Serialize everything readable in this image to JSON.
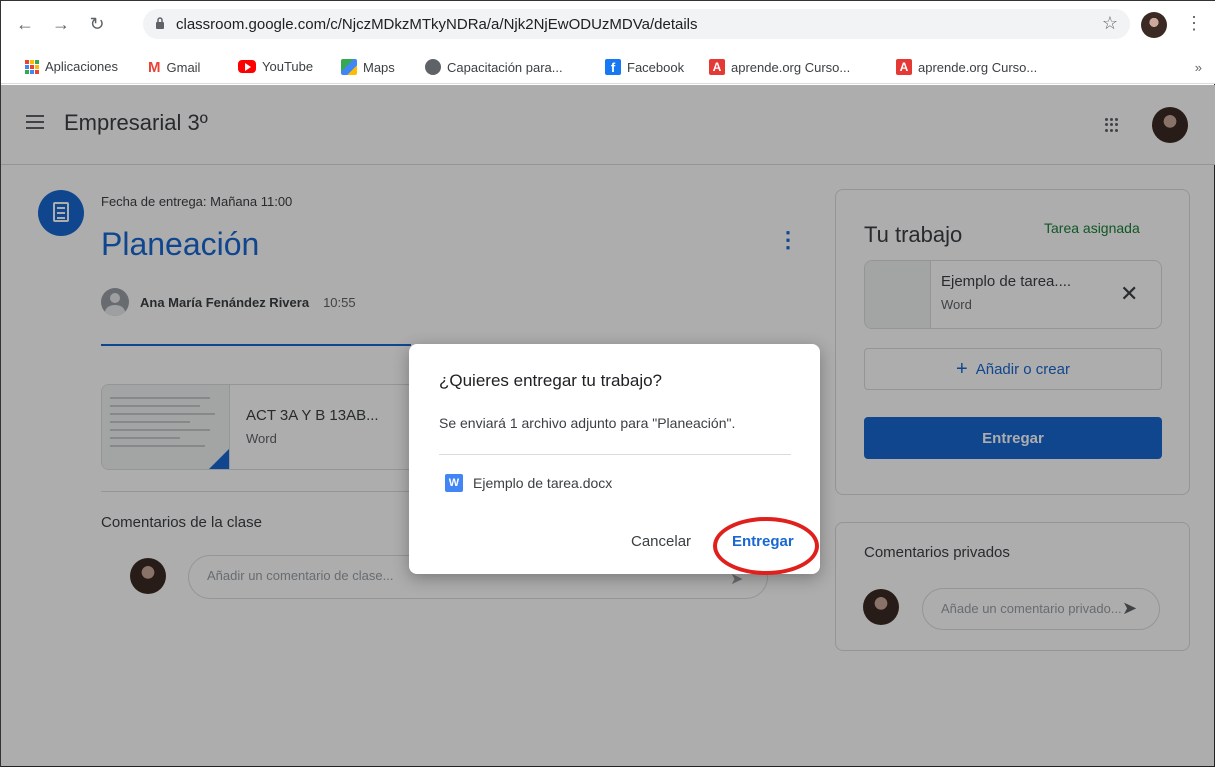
{
  "browser": {
    "url": "classroom.google.com/c/NjczMDkzMTkyNDRa/a/Njk2NjEwODUzMDVa/details",
    "bookmarks": [
      {
        "label": "Aplicaciones",
        "icon": "apps-grid-icon",
        "color": "#fbbc04"
      },
      {
        "label": "Gmail",
        "icon": "gmail-icon",
        "color": "#ea4335"
      },
      {
        "label": "YouTube",
        "icon": "youtube-icon",
        "color": "#ff0000"
      },
      {
        "label": "Maps",
        "icon": "maps-icon",
        "color": "#34a853"
      },
      {
        "label": "Capacitación para...",
        "icon": "globe-icon",
        "color": "#5f6368"
      },
      {
        "label": "Facebook",
        "icon": "facebook-icon",
        "color": "#1877f2"
      },
      {
        "label": "aprende.org Curso...",
        "icon": "aprende-icon",
        "color": "#e53935"
      },
      {
        "label": "aprende.org Curso...",
        "icon": "aprende-icon",
        "color": "#e53935"
      }
    ],
    "more": "»"
  },
  "header": {
    "class_name": "Empresarial 3º"
  },
  "assignment": {
    "due": "Fecha de entrega: Mañana 11:00",
    "title": "Planeación",
    "author": "Ana María Fenández Rivera",
    "time": "10:55",
    "attachment": {
      "name": "ACT 3A Y B 13AB...",
      "type": "Word"
    },
    "class_comments_heading": "Comentarios de la clase",
    "class_comment_placeholder": "Añadir un comentario de clase..."
  },
  "work": {
    "title": "Tu trabajo",
    "status": "Tarea asignada",
    "file": {
      "name": "Ejemplo de tarea....",
      "type": "Word"
    },
    "add_label": "Añadir o crear",
    "submit_label": "Entregar"
  },
  "private": {
    "title": "Comentarios privados",
    "placeholder": "Añade un comentario privado..."
  },
  "dialog": {
    "title": "¿Quieres entregar tu trabajo?",
    "body": "Se enviará 1 archivo adjunto para \"Planeación\".",
    "file": "Ejemplo de tarea.docx",
    "cancel": "Cancelar",
    "submit": "Entregar"
  },
  "colors": {
    "accent": "#1967d2",
    "status_green": "#188038",
    "highlight_red": "#e0201c"
  }
}
